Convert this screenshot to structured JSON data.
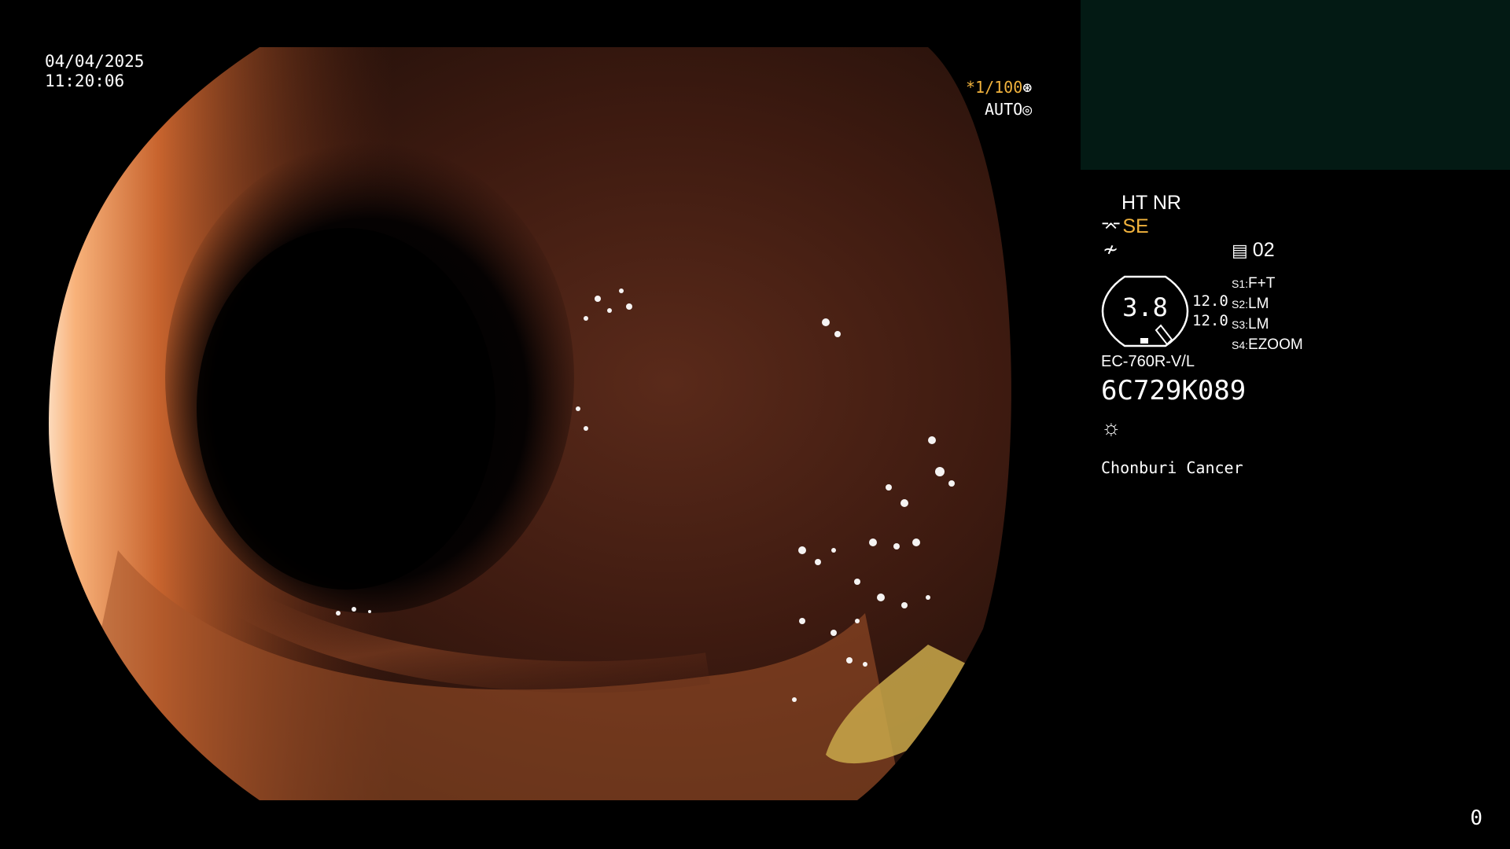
{
  "overlay": {
    "date": "04/04/2025",
    "time": "11:20:06",
    "shutter": "*1/100",
    "shutter_icon": "aperture-icon",
    "iris": "AUTO",
    "iris_icon": "iris-icon"
  },
  "panel": {
    "ht_nr": "HT NR",
    "se_label": "SE",
    "se_icon": "structure-enhance-icon",
    "f_icon": "color-mode-icon",
    "channel_icon": "memory-icon",
    "channel": "02",
    "gauge_value": "3.8",
    "gauge_upper": "12.0",
    "gauge_lower": "12.0",
    "switches": [
      {
        "key": "S1:",
        "value": "F+T"
      },
      {
        "key": "S2:",
        "value": "LM"
      },
      {
        "key": "S3:",
        "value": "LM"
      },
      {
        "key": "S4:",
        "value": "EZOOM"
      }
    ],
    "model": "EC-760R-V/L",
    "serial": "6C729K089",
    "light_icon": "sun-icon",
    "institution": "Chonburi Cancer"
  },
  "frame_counter": "0",
  "colors": {
    "accent": "#f2b33d",
    "preview_box": "#031a14",
    "background": "#000000"
  }
}
